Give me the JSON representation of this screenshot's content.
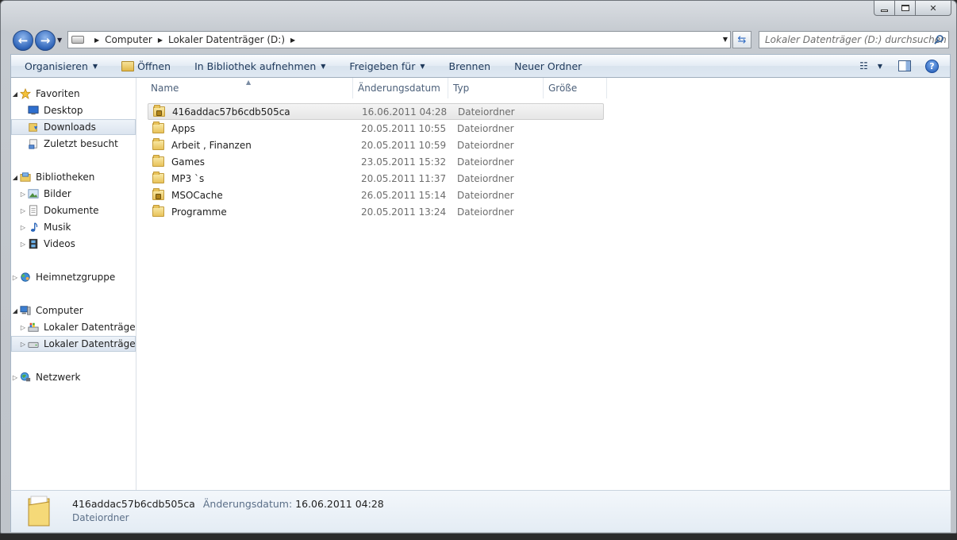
{
  "window": {
    "caption": {
      "minimize": "—",
      "maximize": "□",
      "close": "✕"
    }
  },
  "address_bar": {
    "crumbs": [
      "Computer",
      "Lokaler Datenträger (D:)"
    ],
    "search_placeholder": "Lokaler Datenträger (D:) durchsuchen"
  },
  "toolbar": {
    "organize": "Organisieren",
    "open": "Öffnen",
    "library": "In Bibliothek aufnehmen",
    "share": "Freigeben für",
    "burn": "Brennen",
    "new_folder": "Neuer Ordner",
    "help": "?"
  },
  "sidebar": {
    "favorites": "Favoriten",
    "desktop": "Desktop",
    "downloads": "Downloads",
    "recent": "Zuletzt besucht",
    "libraries": "Bibliotheken",
    "pictures": "Bilder",
    "documents": "Dokumente",
    "music": "Musik",
    "videos": "Videos",
    "homegroup": "Heimnetzgruppe",
    "computer": "Computer",
    "drive_c": "Lokaler Datenträger",
    "drive_d": "Lokaler Datenträger",
    "network": "Netzwerk"
  },
  "columns": {
    "name": "Name",
    "date": "Änderungsdatum",
    "type": "Typ",
    "size": "Größe"
  },
  "files": [
    {
      "name": "416addac57b6cdb505ca",
      "date": "16.06.2011 04:28",
      "type": "Dateiordner"
    },
    {
      "name": "Apps",
      "date": "20.05.2011 10:55",
      "type": "Dateiordner"
    },
    {
      "name": "Arbeit , Finanzen",
      "date": "20.05.2011 10:59",
      "type": "Dateiordner"
    },
    {
      "name": "Games",
      "date": "23.05.2011 15:32",
      "type": "Dateiordner"
    },
    {
      "name": "MP3 `s",
      "date": "20.05.2011 11:37",
      "type": "Dateiordner"
    },
    {
      "name": "MSOCache",
      "date": "26.05.2011 15:14",
      "type": "Dateiordner"
    },
    {
      "name": "Programme",
      "date": "20.05.2011 13:24",
      "type": "Dateiordner"
    }
  ],
  "details": {
    "name": "416addac57b6cdb505ca",
    "date_label": "Änderungsdatum:",
    "date_value": "16.06.2011 04:28",
    "type": "Dateiordner"
  }
}
